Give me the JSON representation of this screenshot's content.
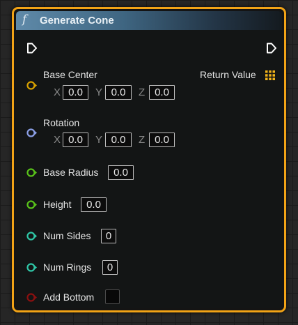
{
  "node": {
    "title": "Generate Cone",
    "func_symbol": "f",
    "accent_color": "#f2a316",
    "header_color": "#3f6682"
  },
  "output": {
    "label": "Return Value",
    "icon": "grid-struct-icon",
    "color": "#f0b21a"
  },
  "pins": {
    "base_center": {
      "label": "Base Center",
      "color": "#d6a000",
      "x_label": "X",
      "x": "0.0",
      "y_label": "Y",
      "y": "0.0",
      "z_label": "Z",
      "z": "0.0"
    },
    "rotation": {
      "label": "Rotation",
      "color": "#8b9fe6",
      "x_label": "X",
      "x": "0.0",
      "y_label": "Y",
      "y": "0.0",
      "z_label": "Z",
      "z": "0.0"
    },
    "base_radius": {
      "label": "Base Radius",
      "value": "0.0",
      "color": "#58c11a"
    },
    "height": {
      "label": "Height",
      "value": "0.0",
      "color": "#58c11a"
    },
    "num_sides": {
      "label": "Num Sides",
      "value": "0",
      "color": "#2fc6a6"
    },
    "num_rings": {
      "label": "Num Rings",
      "value": "0",
      "color": "#2fc6a6"
    },
    "add_bottom": {
      "label": "Add Bottom",
      "checked": false,
      "color": "#8a1010"
    }
  }
}
